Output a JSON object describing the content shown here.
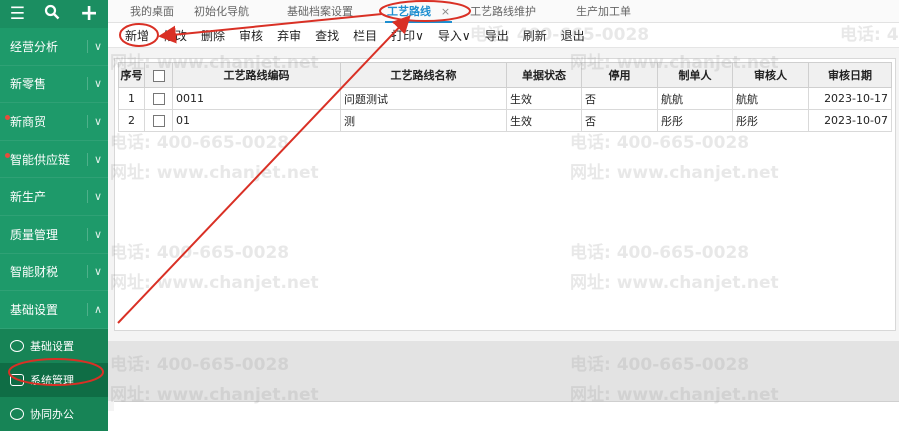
{
  "sidebar": {
    "top_icons": [
      "menu-icon",
      "search-icon",
      "plus-icon"
    ],
    "items": [
      {
        "label": "经营分析",
        "chevron": "∨"
      },
      {
        "label": "新零售",
        "chevron": "∨"
      },
      {
        "label": "新商贸",
        "chevron": "∨"
      },
      {
        "label": "智能供应链",
        "chevron": "∨"
      },
      {
        "label": "新生产",
        "chevron": "∨"
      },
      {
        "label": "质量管理",
        "chevron": "∨"
      },
      {
        "label": "智能财税",
        "chevron": "∨"
      },
      {
        "label": "基础设置",
        "chevron": "∧"
      }
    ],
    "sub_items": [
      {
        "label": "基础设置"
      },
      {
        "label": "系统管理"
      },
      {
        "label": "协同办公"
      }
    ]
  },
  "tabs": [
    "我的桌面",
    "初始化导航",
    "基础档案设置",
    "工艺路线",
    "工艺路线维护",
    "生产加工单"
  ],
  "tab_close": "×",
  "toolbar": [
    "新增",
    "修改",
    "删除",
    "审核",
    "弃审",
    "查找",
    "栏目",
    "打印∨",
    "导入∨",
    "导出",
    "刷新",
    "退出"
  ],
  "table": {
    "headers": [
      "序号",
      "",
      "工艺路线编码",
      "工艺路线名称",
      "单据状态",
      "停用",
      "制单人",
      "审核人",
      "审核日期"
    ],
    "rows": [
      [
        "1",
        "",
        "0011",
        "问题测试",
        "生效",
        "否",
        "航航",
        "航航",
        "2023-10-17"
      ],
      [
        "2",
        "",
        "01",
        "测",
        "生效",
        "否",
        "彤彤",
        "彤彤",
        "2023-10-07"
      ]
    ]
  },
  "watermark": {
    "phone": "电话: 400-665-0028",
    "site": "网址: www.chanjet.net"
  },
  "colors": {
    "sidebar": "#1e9a6a",
    "active_tab": "#1e8fd0",
    "annotation": "#d93025"
  }
}
